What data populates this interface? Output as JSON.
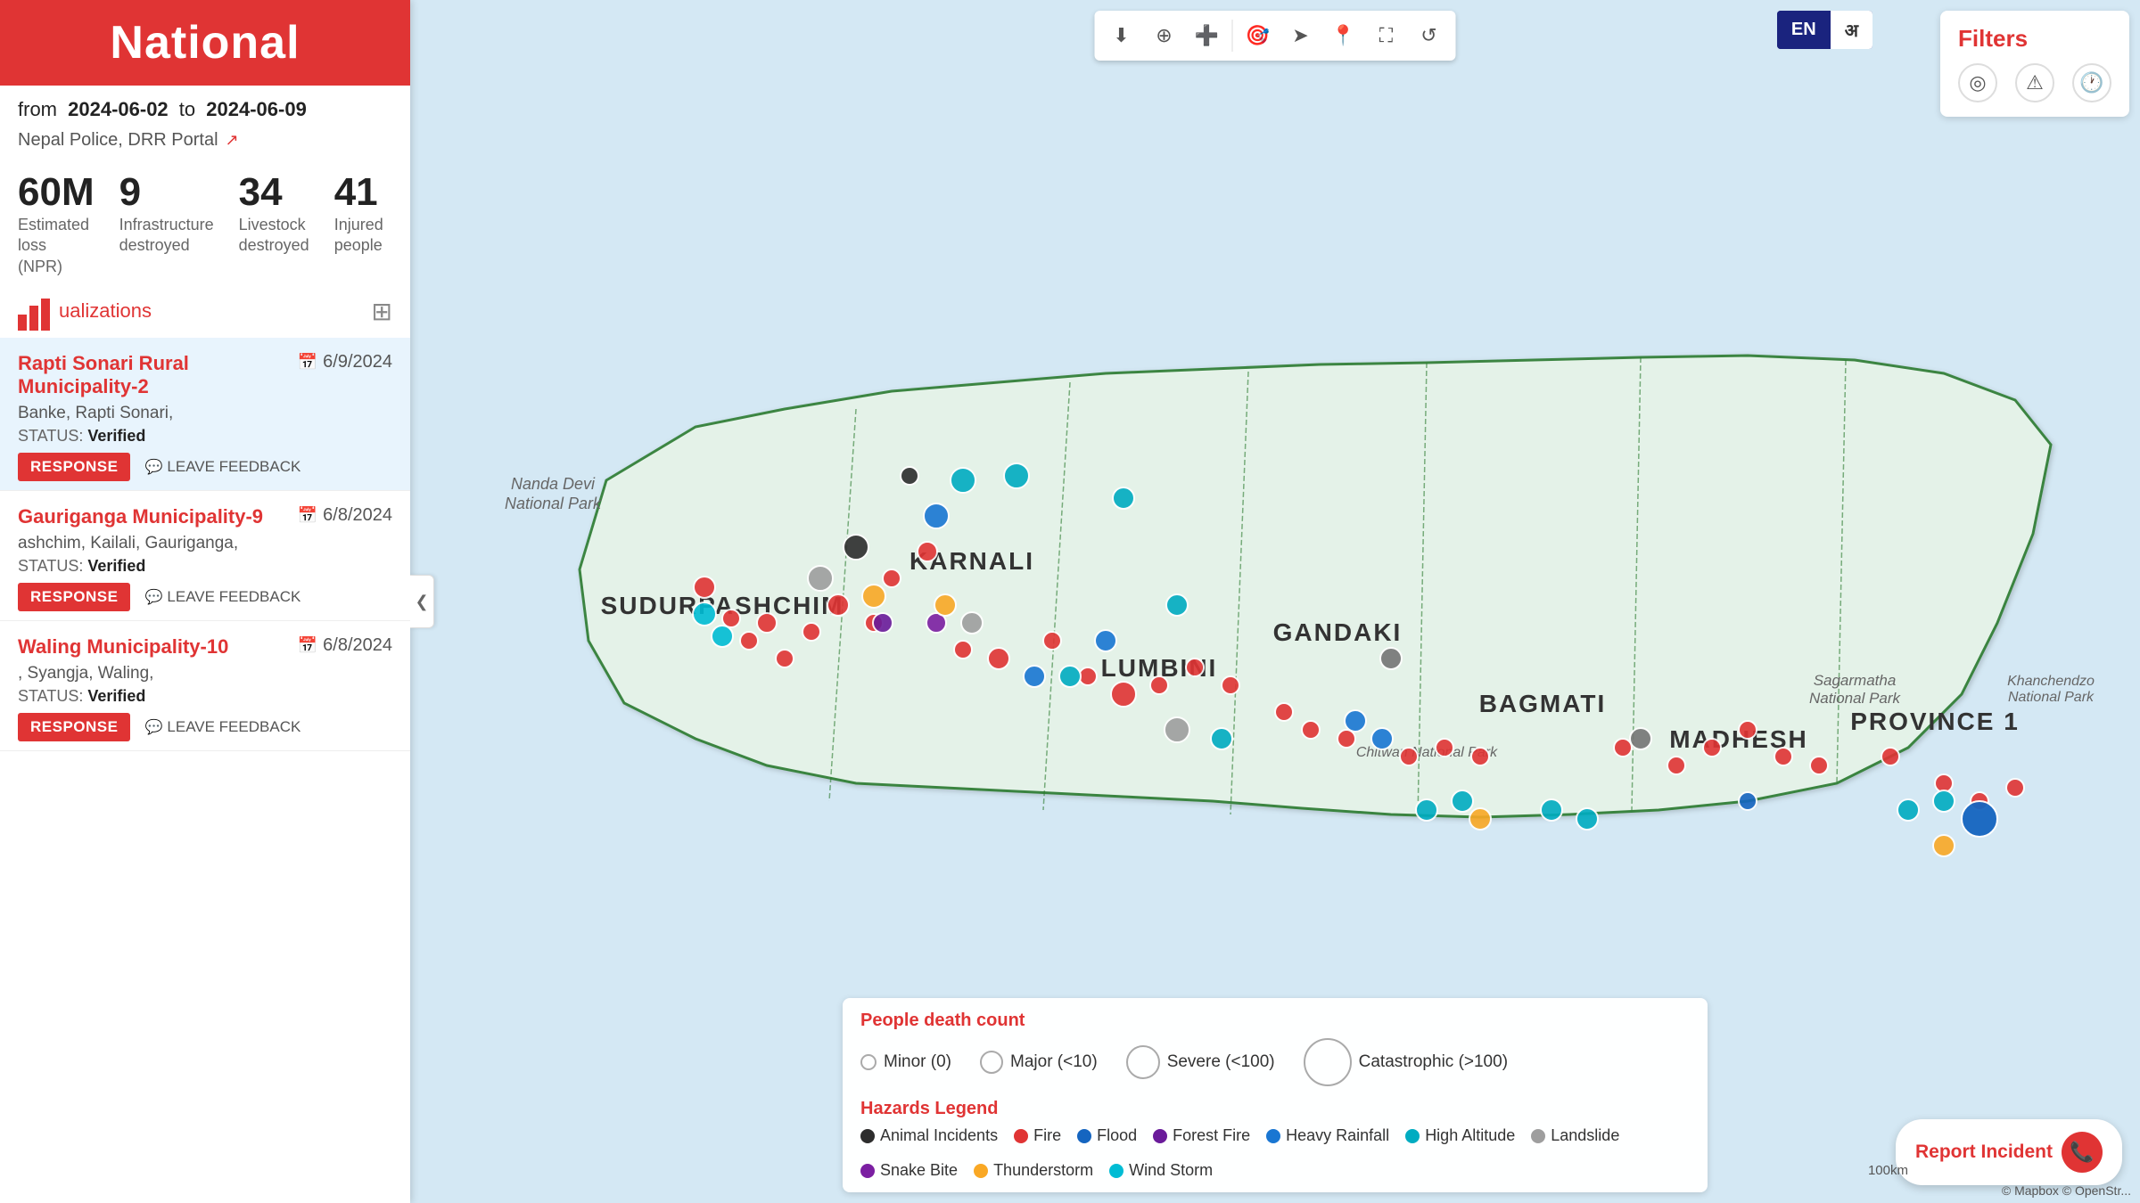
{
  "header": {
    "title": "National",
    "bg_color": "#e03434"
  },
  "date_range": {
    "label_from": "from",
    "from": "2024-06-02",
    "label_to": "to",
    "to": "2024-06-09"
  },
  "sources": {
    "label": "Nepal Police,  DRR Portal"
  },
  "stats": [
    {
      "value": "60M",
      "label": "Estimated loss\n(NPR)"
    },
    {
      "value": "9",
      "label": "Infrastructure\ndestroyed"
    },
    {
      "value": "34",
      "label": "Livestock\ndestroyed"
    },
    {
      "value": "41",
      "label": "Injured people"
    }
  ],
  "visualizations_label": "ualizations",
  "incidents": [
    {
      "title": "Rapti Sonari Rural Municipality-2",
      "date": "6/9/2024",
      "location": "Banke,  Rapti Sonari,",
      "status": "Verified",
      "active": true
    },
    {
      "title": "Gauriganga Municipality-9",
      "date": "6/8/2024",
      "location": "ashchim, Kailali,  Gauriganga,",
      "status": "Verified",
      "active": false
    },
    {
      "title": "Waling Municipality-10",
      "date": "6/8/2024",
      "location": ", Syangja,  Waling,",
      "status": "Verified",
      "active": false
    }
  ],
  "actions": {
    "response": "RESPONSE",
    "feedback": "LEAVE FEEDBACK"
  },
  "toolbar": {
    "download_icon": "⬇",
    "layers_icon": "⊕",
    "crosshair_icon": "+",
    "location_icon": "⊕",
    "arrow_icon": "➤",
    "pin_icon": "📍",
    "fullscreen_icon": "⛶",
    "refresh_icon": "↺"
  },
  "lang": {
    "en": "EN",
    "ne": "अ"
  },
  "filters": {
    "title": "Filters",
    "location_icon": "◎",
    "warning_icon": "⚠",
    "clock_icon": "🕐"
  },
  "map": {
    "regions": [
      "SUDURPASHCHIM",
      "KARNALI",
      "GANDAKI",
      "LUMBINI",
      "BAGMATI",
      "MADHESH",
      "PROVINCE 1"
    ],
    "nanda_devi": "Nanda Devi\nNational Park",
    "sagarmatha": "Sagarmatha\nNational Park",
    "chitwan": "Chitwan National Park",
    "khanchendzo": "Khanchendzo\nNational Park"
  },
  "legend": {
    "death_count_title": "People death count",
    "death_items": [
      {
        "label": "Minor (0)",
        "size": 18
      },
      {
        "label": "Major (<10)",
        "size": 26
      },
      {
        "label": "Severe (<100)",
        "size": 38
      },
      {
        "label": "Catastrophic (>100)",
        "size": 54
      }
    ],
    "hazards_title": "Hazards Legend",
    "hazards": [
      {
        "label": "Animal Incidents",
        "color": "#2d2d2d"
      },
      {
        "label": "Fire",
        "color": "#e03434"
      },
      {
        "label": "Flood",
        "color": "#1565c0"
      },
      {
        "label": "Forest Fire",
        "color": "#4a148c"
      },
      {
        "label": "Heavy Rainfall",
        "color": "#1976d2"
      },
      {
        "label": "High Altitude",
        "color": "#00acc1"
      },
      {
        "label": "Landslide",
        "color": "#9e9e9e"
      },
      {
        "label": "Snake Bite",
        "color": "#7b1fa2"
      },
      {
        "label": "Thunderstorm",
        "color": "#f9a825"
      },
      {
        "label": "Wind Storm",
        "color": "#00bcd4"
      }
    ]
  },
  "report_btn": "Report Incident",
  "attribution": "© Mapbox © OpenStr...",
  "scale": "100km",
  "collapse_icon": "❮"
}
